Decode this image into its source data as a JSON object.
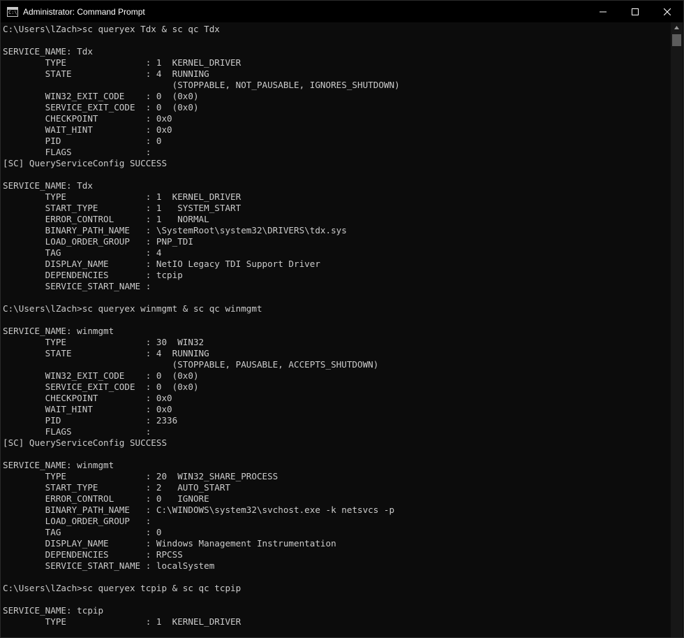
{
  "window": {
    "title": "Administrator: Command Prompt",
    "icon_label": "C:\\",
    "icons": {
      "app": "cmd-icon",
      "minimize": "minimize-icon",
      "maximize": "maximize-icon",
      "close": "close-icon"
    }
  },
  "console": {
    "lines": [
      "C:\\Users\\lZach>sc queryex Tdx & sc qc Tdx",
      "",
      "SERVICE_NAME: Tdx",
      "        TYPE               : 1  KERNEL_DRIVER",
      "        STATE              : 4  RUNNING",
      "                                (STOPPABLE, NOT_PAUSABLE, IGNORES_SHUTDOWN)",
      "        WIN32_EXIT_CODE    : 0  (0x0)",
      "        SERVICE_EXIT_CODE  : 0  (0x0)",
      "        CHECKPOINT         : 0x0",
      "        WAIT_HINT          : 0x0",
      "        PID                : 0",
      "        FLAGS              :",
      "[SC] QueryServiceConfig SUCCESS",
      "",
      "SERVICE_NAME: Tdx",
      "        TYPE               : 1  KERNEL_DRIVER",
      "        START_TYPE         : 1   SYSTEM_START",
      "        ERROR_CONTROL      : 1   NORMAL",
      "        BINARY_PATH_NAME   : \\SystemRoot\\system32\\DRIVERS\\tdx.sys",
      "        LOAD_ORDER_GROUP   : PNP_TDI",
      "        TAG                : 4",
      "        DISPLAY_NAME       : NetIO Legacy TDI Support Driver",
      "        DEPENDENCIES       : tcpip",
      "        SERVICE_START_NAME :",
      "",
      "C:\\Users\\lZach>sc queryex winmgmt & sc qc winmgmt",
      "",
      "SERVICE_NAME: winmgmt",
      "        TYPE               : 30  WIN32",
      "        STATE              : 4  RUNNING",
      "                                (STOPPABLE, PAUSABLE, ACCEPTS_SHUTDOWN)",
      "        WIN32_EXIT_CODE    : 0  (0x0)",
      "        SERVICE_EXIT_CODE  : 0  (0x0)",
      "        CHECKPOINT         : 0x0",
      "        WAIT_HINT          : 0x0",
      "        PID                : 2336",
      "        FLAGS              :",
      "[SC] QueryServiceConfig SUCCESS",
      "",
      "SERVICE_NAME: winmgmt",
      "        TYPE               : 20  WIN32_SHARE_PROCESS",
      "        START_TYPE         : 2   AUTO_START",
      "        ERROR_CONTROL      : 0   IGNORE",
      "        BINARY_PATH_NAME   : C:\\WINDOWS\\system32\\svchost.exe -k netsvcs -p",
      "        LOAD_ORDER_GROUP   :",
      "        TAG                : 0",
      "        DISPLAY_NAME       : Windows Management Instrumentation",
      "        DEPENDENCIES       : RPCSS",
      "        SERVICE_START_NAME : localSystem",
      "",
      "C:\\Users\\lZach>sc queryex tcpip & sc qc tcpip",
      "",
      "SERVICE_NAME: tcpip",
      "        TYPE               : 1  KERNEL_DRIVER"
    ]
  },
  "colors": {
    "background": "#0c0c0c",
    "text": "#cccccc",
    "titlebar": "#000000",
    "scroll_thumb": "#5c5c5c"
  }
}
